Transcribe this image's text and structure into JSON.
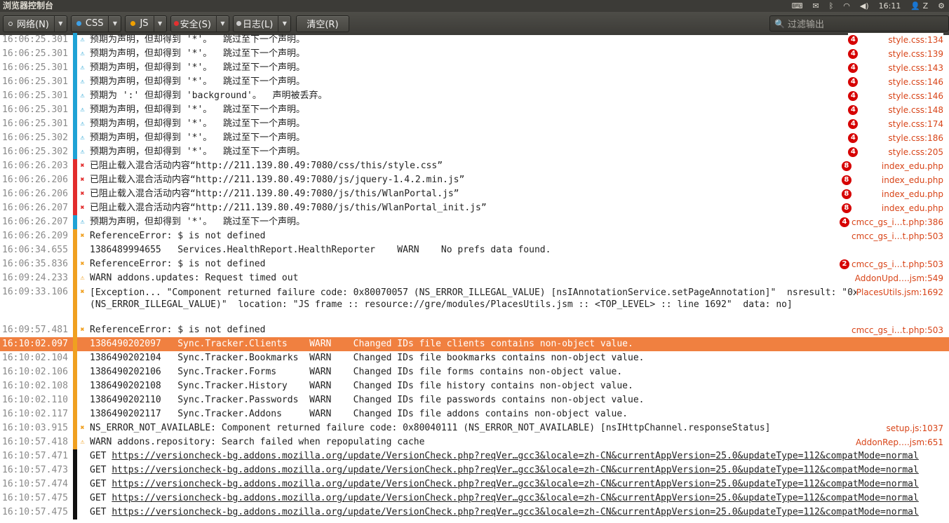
{
  "window": {
    "title": "浏览器控制台",
    "time": "16:11",
    "user": "Z"
  },
  "toolbar": {
    "buttons": [
      {
        "label": "网络(N)",
        "dot": "#dddddd",
        "dot_style": "hollow"
      },
      {
        "label": "CSS",
        "dot": "#3ea0e6"
      },
      {
        "label": "JS",
        "dot": "#f0a000"
      },
      {
        "label": "安全(S)",
        "dot": "#e33030"
      },
      {
        "label": "日志(L)",
        "dot": "#cccccc"
      }
    ],
    "clear_label": "清空(R)",
    "filter_placeholder": "过滤输出"
  },
  "colors": {
    "css": "#1fa2d5",
    "security": "#e22c2c",
    "js": "#f0a020",
    "log": "#111111",
    "selected": "#f08040"
  },
  "rows": [
    {
      "time": "16:06:25.301",
      "cat": "css",
      "icon": "warn",
      "msg": "预期为声明，但却得到 '*'。  跳过至下一个声明。",
      "badge": "4",
      "src": "style.css:134"
    },
    {
      "time": "16:06:25.301",
      "cat": "css",
      "icon": "warn",
      "msg": "预期为声明，但却得到 '*'。  跳过至下一个声明。",
      "badge": "4",
      "src": "style.css:139"
    },
    {
      "time": "16:06:25.301",
      "cat": "css",
      "icon": "warn",
      "msg": "预期为声明，但却得到 '*'。  跳过至下一个声明。",
      "badge": "4",
      "src": "style.css:143"
    },
    {
      "time": "16:06:25.301",
      "cat": "css",
      "icon": "warn",
      "msg": "预期为声明，但却得到 '*'。  跳过至下一个声明。",
      "badge": "4",
      "src": "style.css:146"
    },
    {
      "time": "16:06:25.301",
      "cat": "css",
      "icon": "warn",
      "msg": "预期为 ':' 但却得到 'background'。  声明被丢弃。",
      "badge": "4",
      "src": "style.css:146"
    },
    {
      "time": "16:06:25.301",
      "cat": "css",
      "icon": "warn",
      "msg": "预期为声明，但却得到 '*'。  跳过至下一个声明。",
      "badge": "4",
      "src": "style.css:148"
    },
    {
      "time": "16:06:25.301",
      "cat": "css",
      "icon": "warn",
      "msg": "预期为声明，但却得到 '*'。  跳过至下一个声明。",
      "badge": "4",
      "src": "style.css:174"
    },
    {
      "time": "16:06:25.302",
      "cat": "css",
      "icon": "warn",
      "msg": "预期为声明，但却得到 '*'。  跳过至下一个声明。",
      "badge": "4",
      "src": "style.css:186"
    },
    {
      "time": "16:06:25.302",
      "cat": "css",
      "icon": "warn",
      "msg": "预期为声明，但却得到 '*'。  跳过至下一个声明。",
      "badge": "4",
      "src": "style.css:205"
    },
    {
      "time": "16:06:26.203",
      "cat": "security",
      "icon": "error",
      "msg": "已阻止载入混合活动内容“http://211.139.80.49:7080/css/this/style.css”",
      "badge": "8",
      "src": "index_edu.php"
    },
    {
      "time": "16:06:26.206",
      "cat": "security",
      "icon": "error",
      "msg": "已阻止载入混合活动内容“http://211.139.80.49:7080/js/jquery-1.4.2.min.js”",
      "badge": "8",
      "src": "index_edu.php"
    },
    {
      "time": "16:06:26.206",
      "cat": "security",
      "icon": "error",
      "msg": "已阻止载入混合活动内容“http://211.139.80.49:7080/js/this/WlanPortal.js”",
      "badge": "8",
      "src": "index_edu.php"
    },
    {
      "time": "16:06:26.207",
      "cat": "security",
      "icon": "error",
      "msg": "已阻止载入混合活动内容“http://211.139.80.49:7080/js/this/WlanPortal_init.js”",
      "badge": "8",
      "src": "index_edu.php"
    },
    {
      "time": "16:06:26.207",
      "cat": "css",
      "icon": "warn",
      "msg": "预期为声明，但却得到 '*'。  跳过至下一个声明。",
      "badge": "4",
      "src": "cmcc_gs_i…t.php:386"
    },
    {
      "time": "16:06:26.209",
      "cat": "js",
      "icon": "error",
      "msg": "ReferenceError: $ is not defined",
      "badge": "",
      "src": "cmcc_gs_i…t.php:503"
    },
    {
      "time": "16:06:34.655",
      "cat": "js",
      "icon": "",
      "msg": "1386489994655   Services.HealthReport.HealthReporter    WARN    No prefs data found.",
      "badge": "",
      "src": ""
    },
    {
      "time": "16:06:35.836",
      "cat": "js",
      "icon": "error",
      "msg": "ReferenceError: $ is not defined",
      "badge": "2",
      "src": "cmcc_gs_i…t.php:503"
    },
    {
      "time": "16:09:24.233",
      "cat": "js",
      "icon": "warn",
      "msg": "WARN addons.updates: Request timed out",
      "badge": "",
      "src": "AddonUpd….jsm:549"
    },
    {
      "time": "16:09:33.106",
      "cat": "js",
      "icon": "error",
      "wrap": true,
      "msg": "[Exception... \"Component returned failure code: 0x80070057 (NS_ERROR_ILLEGAL_VALUE) [nsIAnnotationService.setPageAnnotation]\"  nsresult: \"0x80070057 (NS_ERROR_ILLEGAL_VALUE)\"  location: \"JS frame :: resource://gre/modules/PlacesUtils.jsm :: <TOP_LEVEL> :: line 1692\"  data: no]",
      "badge": "",
      "src": "PlacesUtils.jsm:1692"
    },
    {
      "time": "16:09:57.481",
      "cat": "js",
      "icon": "error",
      "msg": "ReferenceError: $ is not defined",
      "badge": "",
      "src": "cmcc_gs_i…t.php:503"
    },
    {
      "time": "16:10:02.097",
      "cat": "js",
      "icon": "",
      "selected": true,
      "msg": "1386490202097   Sync.Tracker.Clients    WARN    Changed IDs file clients contains non-object value.",
      "badge": "",
      "src": ""
    },
    {
      "time": "16:10:02.104",
      "cat": "js",
      "icon": "",
      "msg": "1386490202104   Sync.Tracker.Bookmarks  WARN    Changed IDs file bookmarks contains non-object value.",
      "badge": "",
      "src": ""
    },
    {
      "time": "16:10:02.106",
      "cat": "js",
      "icon": "",
      "msg": "1386490202106   Sync.Tracker.Forms      WARN    Changed IDs file forms contains non-object value.",
      "badge": "",
      "src": ""
    },
    {
      "time": "16:10:02.108",
      "cat": "js",
      "icon": "",
      "msg": "1386490202108   Sync.Tracker.History    WARN    Changed IDs file history contains non-object value.",
      "badge": "",
      "src": ""
    },
    {
      "time": "16:10:02.110",
      "cat": "js",
      "icon": "",
      "msg": "1386490202110   Sync.Tracker.Passwords  WARN    Changed IDs file passwords contains non-object value.",
      "badge": "",
      "src": ""
    },
    {
      "time": "16:10:02.117",
      "cat": "js",
      "icon": "",
      "msg": "1386490202117   Sync.Tracker.Addons     WARN    Changed IDs file addons contains non-object value.",
      "badge": "",
      "src": ""
    },
    {
      "time": "16:10:03.915",
      "cat": "js",
      "icon": "error",
      "msg": "NS_ERROR_NOT_AVAILABLE: Component returned failure code: 0x80040111 (NS_ERROR_NOT_AVAILABLE) [nsIHttpChannel.responseStatus]",
      "badge": "",
      "src": "setup.js:1037"
    },
    {
      "time": "16:10:57.418",
      "cat": "js",
      "icon": "warn",
      "msg": "WARN addons.repository: Search failed when repopulating cache",
      "badge": "",
      "src": "AddonRep….jsm:651"
    },
    {
      "time": "16:10:57.471",
      "cat": "log",
      "icon": "",
      "method": "GET",
      "link": "https://versioncheck-bg.addons.mozilla.org/update/VersionCheck.php?reqVer…gcc3&locale=zh-CN&currentAppVersion=25.0&updateType=112&compatMode=normal",
      "badge": "",
      "src": ""
    },
    {
      "time": "16:10:57.473",
      "cat": "log",
      "icon": "",
      "method": "GET",
      "link": "https://versioncheck-bg.addons.mozilla.org/update/VersionCheck.php?reqVer…gcc3&locale=zh-CN&currentAppVersion=25.0&updateType=112&compatMode=normal",
      "badge": "",
      "src": ""
    },
    {
      "time": "16:10:57.474",
      "cat": "log",
      "icon": "",
      "method": "GET",
      "link": "https://versioncheck-bg.addons.mozilla.org/update/VersionCheck.php?reqVer…gcc3&locale=zh-CN&currentAppVersion=25.0&updateType=112&compatMode=normal",
      "badge": "",
      "src": ""
    },
    {
      "time": "16:10:57.475",
      "cat": "log",
      "icon": "",
      "method": "GET",
      "link": "https://versioncheck-bg.addons.mozilla.org/update/VersionCheck.php?reqVer…gcc3&locale=zh-CN&currentAppVersion=25.0&updateType=112&compatMode=normal",
      "badge": "",
      "src": ""
    },
    {
      "time": "16:10:57.475",
      "cat": "log",
      "icon": "",
      "method": "GET",
      "link": "https://versioncheck-bg.addons.mozilla.org/update/VersionCheck.php?reqVer…gcc3&locale=zh-CN&currentAppVersion=25.0&updateType=112&compatMode=normal",
      "badge": "",
      "src": ""
    }
  ]
}
